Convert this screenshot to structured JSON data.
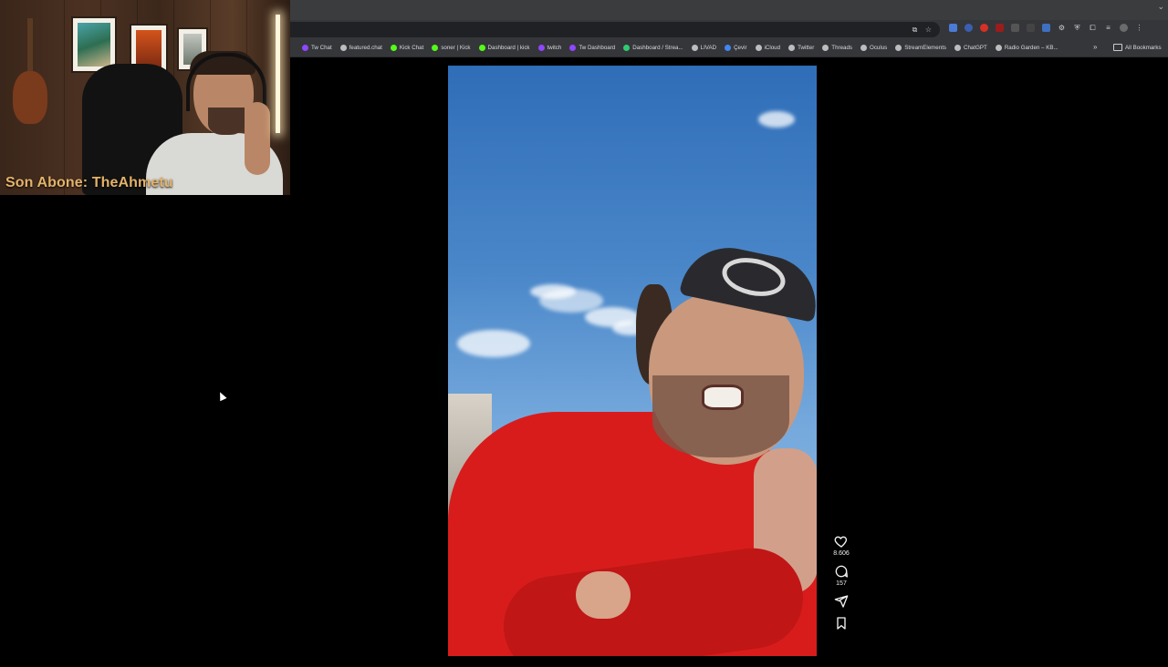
{
  "webcam": {
    "overlay_text": "Son Abone: TheAhmetu"
  },
  "browser": {
    "bookmarks": [
      {
        "label": "Tw Chat",
        "color": "#9146ff"
      },
      {
        "label": "featured.chat",
        "color": "#bdbdbd"
      },
      {
        "label": "Kick Chat",
        "color": "#53fc18"
      },
      {
        "label": "soner | Kick",
        "color": "#53fc18"
      },
      {
        "label": "Dashboard | kick",
        "color": "#53fc18"
      },
      {
        "label": "twitch",
        "color": "#9146ff"
      },
      {
        "label": "Tw Dashboard",
        "color": "#9146ff"
      },
      {
        "label": "Dashboard / Strea...",
        "color": "#2ecc71"
      },
      {
        "label": "LIVAD",
        "color": "#bdbdbd"
      },
      {
        "label": "Çevir",
        "color": "#4285f4"
      },
      {
        "label": "iCloud",
        "color": "#bdbdbd"
      },
      {
        "label": "Twitter",
        "color": "#bdbdbd"
      },
      {
        "label": "Threads",
        "color": "#bdbdbd"
      },
      {
        "label": "Oculus",
        "color": "#bdbdbd"
      },
      {
        "label": "StreamElements",
        "color": "#bdbdbd"
      },
      {
        "label": "ChatGPT",
        "color": "#bdbdbd"
      },
      {
        "label": "Radio Garden – KB...",
        "color": "#bdbdbd"
      }
    ],
    "more_glyph": "»",
    "all_bookmarks": "All Bookmarks"
  },
  "reel": {
    "likes": "8.606",
    "comments": "157"
  }
}
